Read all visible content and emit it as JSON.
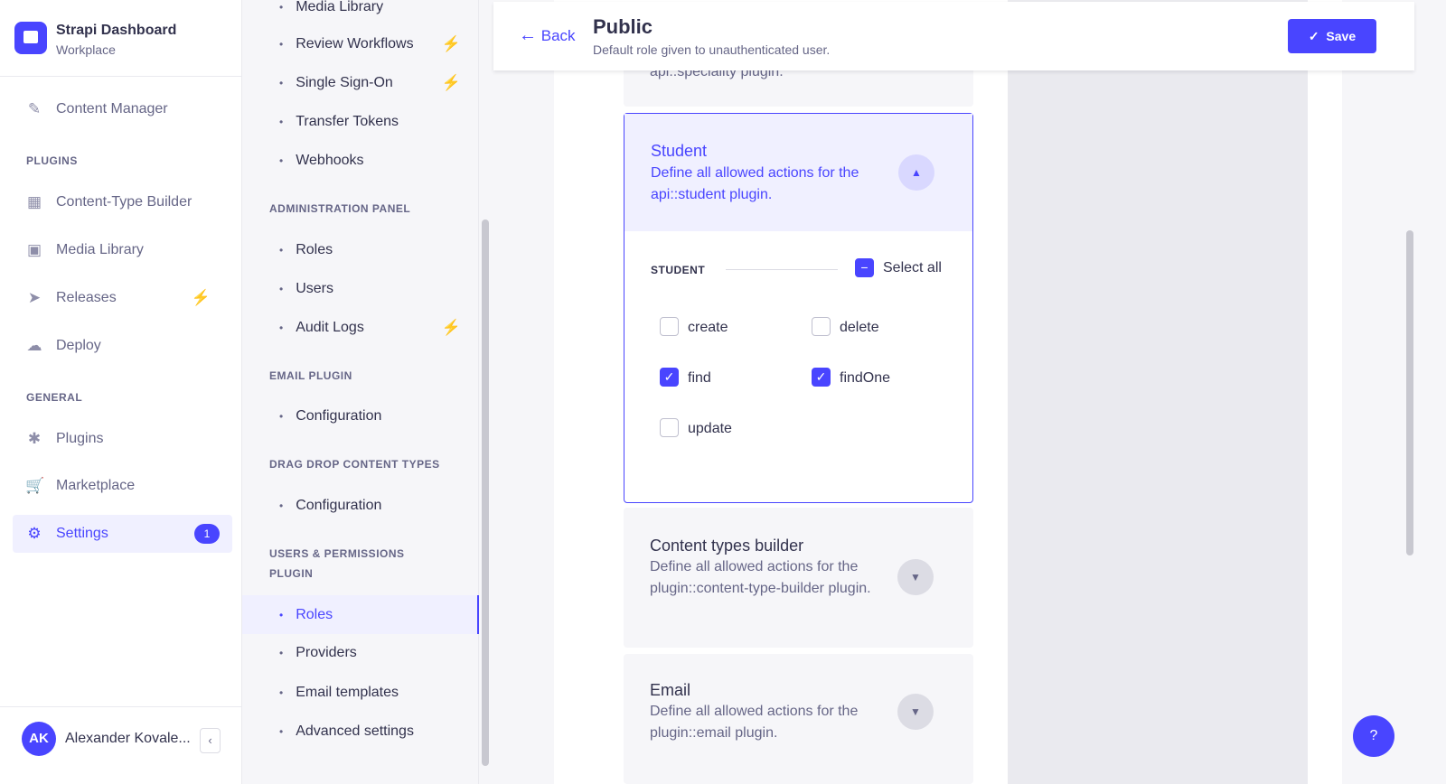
{
  "brand": {
    "title": "Strapi Dashboard",
    "subtitle": "Workplace"
  },
  "sidebar": {
    "content_manager": "Content Manager",
    "plugins_title": "PLUGINS",
    "plugins": [
      "Content-Type Builder",
      "Media Library",
      "Releases",
      "Deploy"
    ],
    "general_title": "GENERAL",
    "general": [
      "Plugins",
      "Marketplace",
      "Settings"
    ],
    "settings_badge": "1",
    "user_initials": "AK",
    "user_name": "Alexander Kovale..."
  },
  "subnav": {
    "items_top": [
      "Media Library",
      "Review Workflows",
      "Single Sign-On",
      "Transfer Tokens",
      "Webhooks"
    ],
    "admin_title": "ADMINISTRATION PANEL",
    "admin": [
      "Roles",
      "Users",
      "Audit Logs"
    ],
    "email_title": "EMAIL PLUGIN",
    "email": [
      "Configuration"
    ],
    "dnd_title": "DRAG DROP CONTENT TYPES",
    "dnd": [
      "Configuration"
    ],
    "up_title": "USERS & PERMISSIONS PLUGIN",
    "up": [
      "Roles",
      "Providers",
      "Email templates",
      "Advanced settings"
    ]
  },
  "header": {
    "back": "Back",
    "title": "Public",
    "subtitle": "Default role given to unauthenticated user.",
    "save": "Save"
  },
  "accordions": {
    "prev_tail": "api::speciality plugin.",
    "student": {
      "title": "Student",
      "desc": "Define all allowed actions for the api::student plugin.",
      "section": "STUDENT",
      "select_all": "Select all",
      "actions": [
        {
          "label": "create",
          "checked": false
        },
        {
          "label": "delete",
          "checked": false
        },
        {
          "label": "find",
          "checked": true
        },
        {
          "label": "findOne",
          "checked": true
        },
        {
          "label": "update",
          "checked": false
        }
      ]
    },
    "ctb": {
      "title": "Content types builder",
      "desc": "Define all allowed actions for the plugin::content-type-builder plugin."
    },
    "email": {
      "title": "Email",
      "desc": "Define all allowed actions for the plugin::email plugin."
    }
  },
  "help": "?",
  "colors": {
    "primary": "#4945ff",
    "bolt": "#f29d41"
  }
}
